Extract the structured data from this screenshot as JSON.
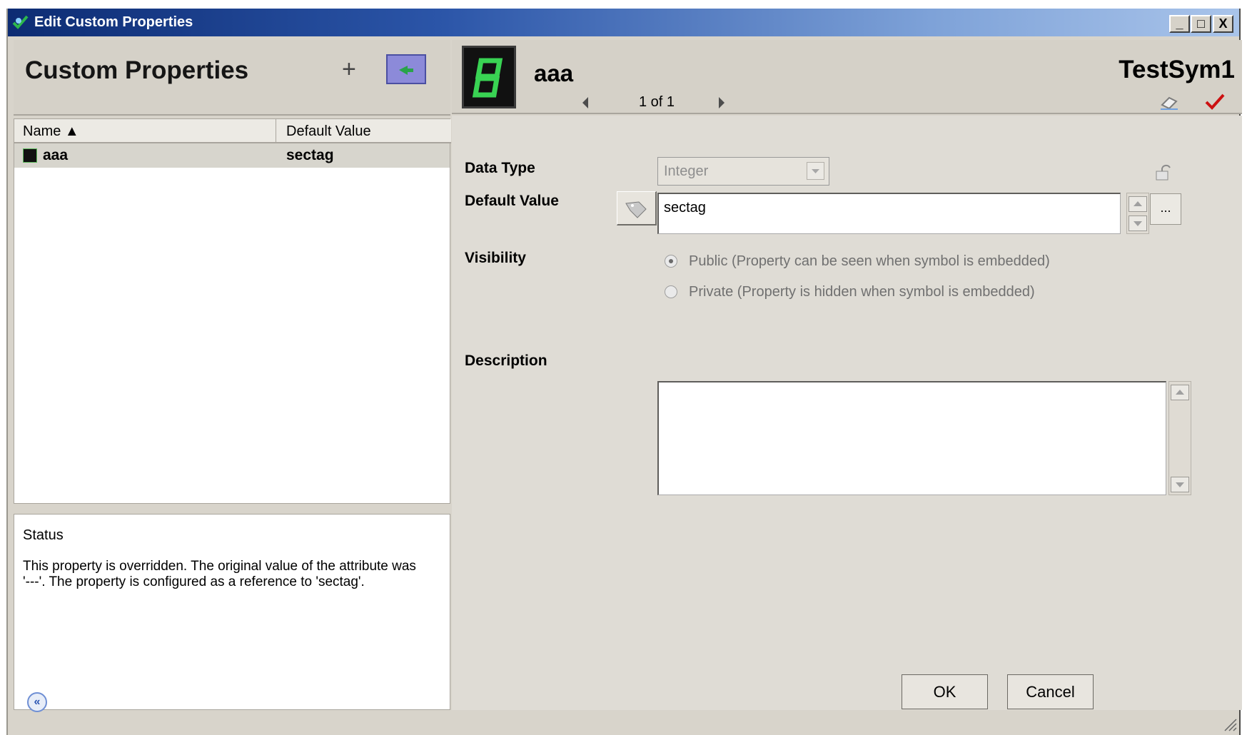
{
  "window": {
    "title": "Edit Custom Properties",
    "minimize": "_",
    "maximize": "□",
    "close": "X"
  },
  "left": {
    "title": "Custom Properties",
    "add_button": "+",
    "grid": {
      "columns": [
        "Name ▲",
        "Default Value"
      ],
      "rows": [
        {
          "name": "aaa",
          "value": "sectag"
        }
      ]
    },
    "status": {
      "title": "Status",
      "text": "This property is overridden.  The original value of the attribute was '---'.  The property is configured as a reference to 'sectag'."
    }
  },
  "right": {
    "property_name": "aaa",
    "symbol_name": "TestSym1",
    "nav": {
      "position": "1 of 1"
    },
    "form": {
      "data_type": {
        "label": "Data Type",
        "value": "Integer"
      },
      "default_value": {
        "label": "Default Value",
        "value": "sectag",
        "browse": "..."
      },
      "visibility": {
        "label": "Visibility",
        "public": "Public (Property can be seen when symbol is embedded)",
        "private": "Private (Property is hidden when symbol is embedded)"
      },
      "description": {
        "label": "Description",
        "value": ""
      }
    }
  },
  "footer": {
    "collapse": "«",
    "ok": "OK",
    "cancel": "Cancel"
  },
  "icons": [
    "app-check-icon",
    "seven-segment-icon",
    "eraser-icon",
    "check-icon",
    "lock-icon",
    "tag-icon",
    "green-arrow-icon",
    "resize-grip-icon"
  ]
}
